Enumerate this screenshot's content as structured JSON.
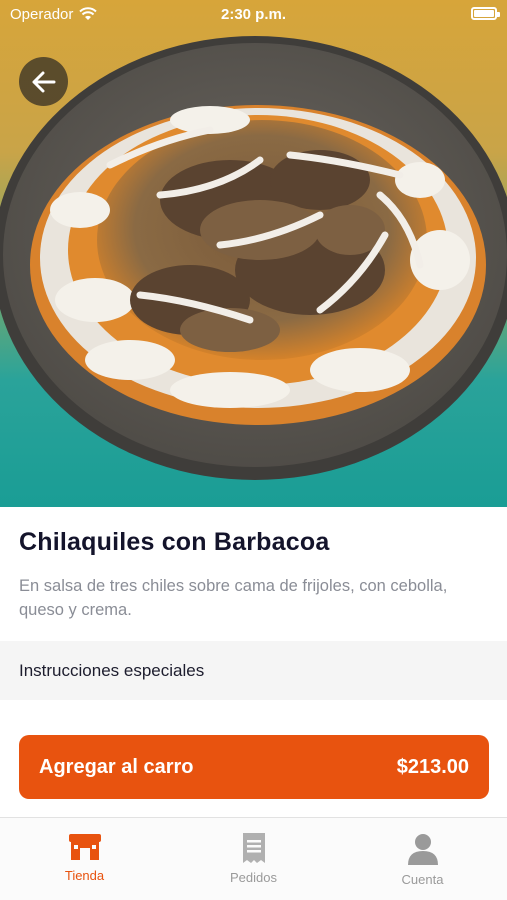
{
  "status_bar": {
    "carrier": "Operador",
    "time": "2:30 p.m."
  },
  "product": {
    "name": "Chilaquiles con Barbacoa",
    "description": "En salsa de tres chiles sobre cama de frijoles, con cebolla, queso y crema.",
    "special_instructions_label": "Instrucciones especiales"
  },
  "cart_button": {
    "label": "Agregar al carro",
    "price": "$213.00"
  },
  "tab_bar": {
    "tabs": [
      {
        "label": "Tienda",
        "icon": "store-icon",
        "active": true
      },
      {
        "label": "Pedidos",
        "icon": "receipt-icon",
        "active": false
      },
      {
        "label": "Cuenta",
        "icon": "person-icon",
        "active": false
      }
    ]
  },
  "colors": {
    "accent": "#e8530f",
    "title": "#14142b",
    "description": "#8a8d96",
    "inactive_tab": "#9a9a9a"
  }
}
